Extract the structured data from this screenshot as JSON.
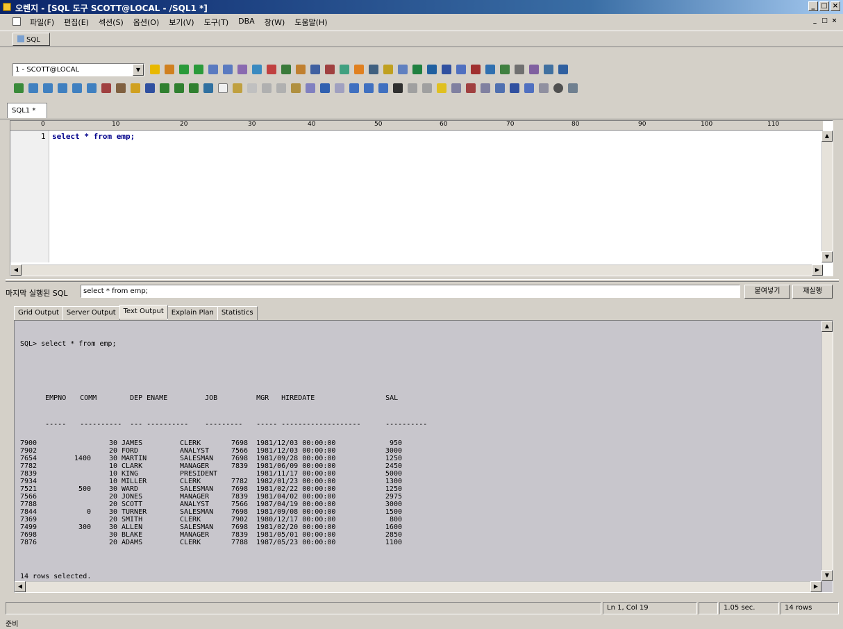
{
  "window": {
    "title": "오렌지 - [SQL 도구 SCOTT@LOCAL - /SQL1 *]",
    "controls": [
      "_",
      "□",
      "×"
    ]
  },
  "menu": {
    "items": [
      "파일(F)",
      "편집(E)",
      "섹션(S)",
      "옵션(O)",
      "보기(V)",
      "도구(T)",
      "DBA",
      "창(W)",
      "도움말(H)"
    ]
  },
  "sql_button": {
    "label": "SQL"
  },
  "connection": {
    "value": "1 - SCOTT@LOCAL"
  },
  "editor_tab": {
    "label": "SQL1 *"
  },
  "ruler": {
    "ticks": [
      "0",
      "10",
      "20",
      "30",
      "40",
      "50",
      "60",
      "70",
      "80",
      "90",
      "100",
      "110"
    ]
  },
  "editor": {
    "line_number": "1",
    "code": "select * from emp;"
  },
  "last_sql": {
    "label": "마지막 실행된 SQL",
    "value": "select * from emp;",
    "paste_button": "붙여넣기",
    "rerun_button": "재실행"
  },
  "output_tabs": [
    "Grid Output",
    "Server Output",
    "Text Output",
    "Explain Plan",
    "Statistics"
  ],
  "output": {
    "prompt": "SQL> select * from emp;",
    "headers": [
      "EMPNO",
      "COMM",
      "DEP",
      "ENAME",
      "JOB",
      "MGR",
      "HIREDATE",
      "SAL"
    ],
    "separators": [
      "-----",
      "----------",
      "---",
      "----------",
      "---------",
      "-----",
      "-------------------",
      "----------"
    ],
    "rows": [
      [
        "7900",
        "",
        "30",
        "JAMES",
        "CLERK",
        "7698",
        "1981/12/03 00:00:00",
        "950"
      ],
      [
        "7902",
        "",
        "20",
        "FORD",
        "ANALYST",
        "7566",
        "1981/12/03 00:00:00",
        "3000"
      ],
      [
        "7654",
        "1400",
        "30",
        "MARTIN",
        "SALESMAN",
        "7698",
        "1981/09/28 00:00:00",
        "1250"
      ],
      [
        "7782",
        "",
        "10",
        "CLARK",
        "MANAGER",
        "7839",
        "1981/06/09 00:00:00",
        "2450"
      ],
      [
        "7839",
        "",
        "10",
        "KING",
        "PRESIDENT",
        "",
        "1981/11/17 00:00:00",
        "5000"
      ],
      [
        "7934",
        "",
        "10",
        "MILLER",
        "CLERK",
        "7782",
        "1982/01/23 00:00:00",
        "1300"
      ],
      [
        "7521",
        "500",
        "30",
        "WARD",
        "SALESMAN",
        "7698",
        "1981/02/22 00:00:00",
        "1250"
      ],
      [
        "7566",
        "",
        "20",
        "JONES",
        "MANAGER",
        "7839",
        "1981/04/02 00:00:00",
        "2975"
      ],
      [
        "7788",
        "",
        "20",
        "SCOTT",
        "ANALYST",
        "7566",
        "1987/04/19 00:00:00",
        "3000"
      ],
      [
        "7844",
        "0",
        "30",
        "TURNER",
        "SALESMAN",
        "7698",
        "1981/09/08 00:00:00",
        "1500"
      ],
      [
        "7369",
        "",
        "20",
        "SMITH",
        "CLERK",
        "7902",
        "1980/12/17 00:00:00",
        "800"
      ],
      [
        "7499",
        "300",
        "30",
        "ALLEN",
        "SALESMAN",
        "7698",
        "1981/02/20 00:00:00",
        "1600"
      ],
      [
        "7698",
        "",
        "30",
        "BLAKE",
        "MANAGER",
        "7839",
        "1981/05/01 00:00:00",
        "2850"
      ],
      [
        "7876",
        "",
        "20",
        "ADAMS",
        "CLERK",
        "7788",
        "1987/05/23 00:00:00",
        "1100"
      ]
    ],
    "footer": "14 rows selected."
  },
  "status": {
    "position": "Ln 1, Col 19",
    "elapsed": "1.05 sec.",
    "rows": "14 rows",
    "bottom": "준비"
  }
}
